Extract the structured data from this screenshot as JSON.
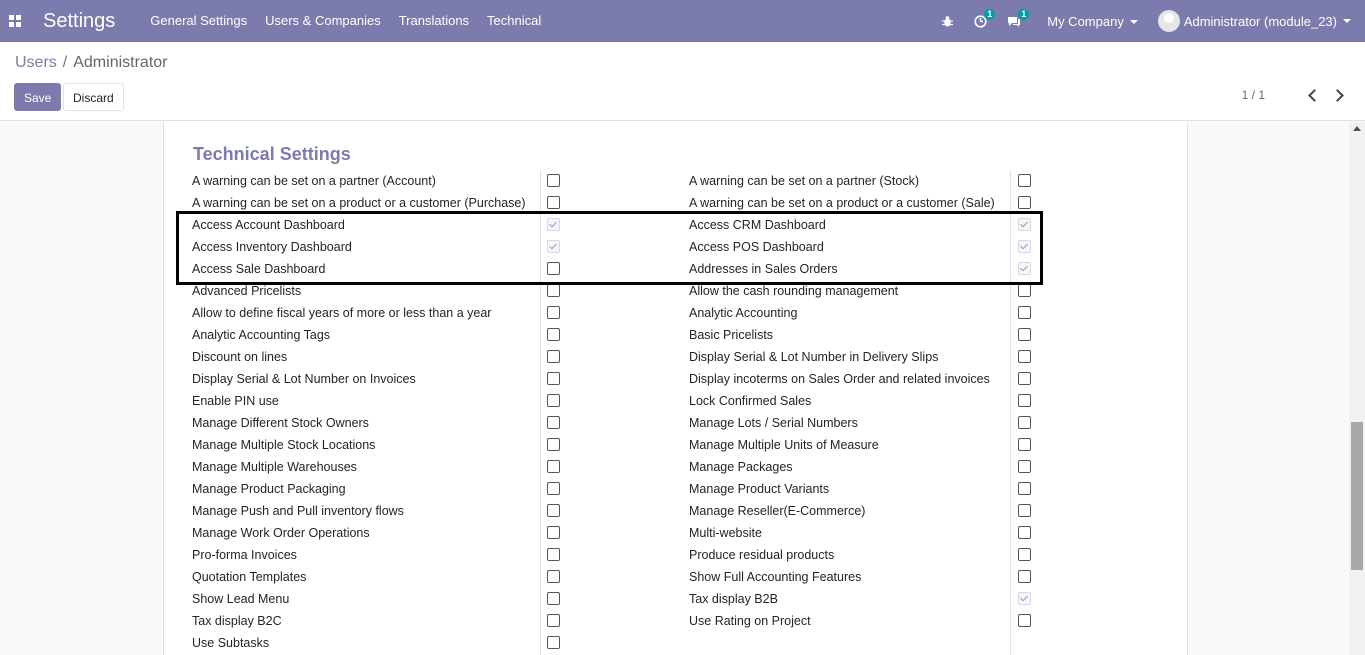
{
  "navbar": {
    "brand": "Settings",
    "menu": [
      "General Settings",
      "Users & Companies",
      "Translations",
      "Technical"
    ],
    "activity_badge": "1",
    "messages_badge": "1",
    "company": "My Company",
    "user": "Administrator (module_23)"
  },
  "breadcrumb": {
    "parent": "Users",
    "separator": "/",
    "current": "Administrator"
  },
  "buttons": {
    "save": "Save",
    "discard": "Discard"
  },
  "pager": {
    "value": "1 / 1"
  },
  "section": {
    "title": "Technical Settings"
  },
  "left_settings": [
    {
      "label": "A warning can be set on a partner (Account)",
      "checked": false
    },
    {
      "label": "A warning can be set on a product or a customer (Purchase)",
      "checked": false
    },
    {
      "label": "Access Account Dashboard",
      "checked": true
    },
    {
      "label": "Access Inventory Dashboard",
      "checked": true
    },
    {
      "label": "Access Sale Dashboard",
      "checked": false
    },
    {
      "label": "Advanced Pricelists",
      "checked": false
    },
    {
      "label": "Allow to define fiscal years of more or less than a year",
      "checked": false
    },
    {
      "label": "Analytic Accounting Tags",
      "checked": false
    },
    {
      "label": "Discount on lines",
      "checked": false
    },
    {
      "label": "Display Serial & Lot Number on Invoices",
      "checked": false
    },
    {
      "label": "Enable PIN use",
      "checked": false
    },
    {
      "label": "Manage Different Stock Owners",
      "checked": false
    },
    {
      "label": "Manage Multiple Stock Locations",
      "checked": false
    },
    {
      "label": "Manage Multiple Warehouses",
      "checked": false
    },
    {
      "label": "Manage Product Packaging",
      "checked": false
    },
    {
      "label": "Manage Push and Pull inventory flows",
      "checked": false
    },
    {
      "label": "Manage Work Order Operations",
      "checked": false
    },
    {
      "label": "Pro-forma Invoices",
      "checked": false
    },
    {
      "label": "Quotation Templates",
      "checked": false
    },
    {
      "label": "Show Lead Menu",
      "checked": false
    },
    {
      "label": "Tax display B2C",
      "checked": false
    },
    {
      "label": "Use Subtasks",
      "checked": false
    }
  ],
  "right_settings": [
    {
      "label": "A warning can be set on a partner (Stock)",
      "checked": false
    },
    {
      "label": "A warning can be set on a product or a customer (Sale)",
      "checked": false
    },
    {
      "label": "Access CRM Dashboard",
      "checked": true
    },
    {
      "label": "Access POS Dashboard",
      "checked": true
    },
    {
      "label": "Addresses in Sales Orders",
      "checked": true
    },
    {
      "label": "Allow the cash rounding management",
      "checked": false
    },
    {
      "label": "Analytic Accounting",
      "checked": false
    },
    {
      "label": "Basic Pricelists",
      "checked": false
    },
    {
      "label": "Display Serial & Lot Number in Delivery Slips",
      "checked": false
    },
    {
      "label": "Display incoterms on Sales Order and related invoices",
      "checked": false
    },
    {
      "label": "Lock Confirmed Sales",
      "checked": false
    },
    {
      "label": "Manage Lots / Serial Numbers",
      "checked": false
    },
    {
      "label": "Manage Multiple Units of Measure",
      "checked": false
    },
    {
      "label": "Manage Packages",
      "checked": false
    },
    {
      "label": "Manage Product Variants",
      "checked": false
    },
    {
      "label": "Manage Reseller(E-Commerce)",
      "checked": false
    },
    {
      "label": "Multi-website",
      "checked": false
    },
    {
      "label": "Produce residual products",
      "checked": false
    },
    {
      "label": "Show Full Accounting Features",
      "checked": false
    },
    {
      "label": "Tax display B2B",
      "checked": true
    },
    {
      "label": "Use Rating on Project",
      "checked": false
    }
  ],
  "colors": {
    "primary": "#7c7bad",
    "badge": "#00a09d"
  }
}
